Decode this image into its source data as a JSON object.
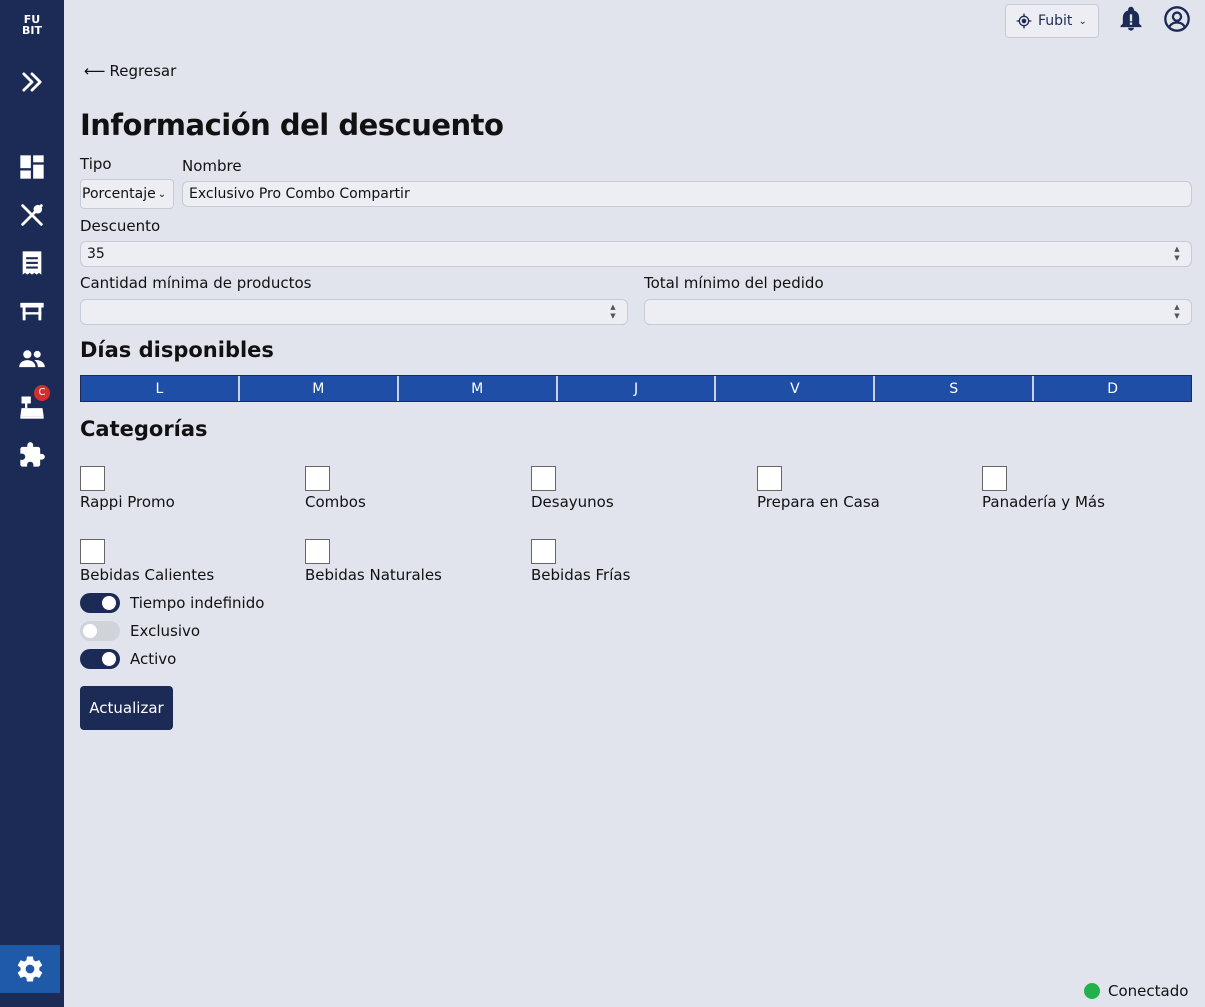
{
  "brand": {
    "logo_text": "FU BIT"
  },
  "topbar": {
    "branch_label": "Fubit"
  },
  "back_link": "Regresar",
  "page_title": "Información del descuento",
  "form": {
    "tipo_label": "Tipo",
    "tipo_value": "Porcentaje",
    "nombre_label": "Nombre",
    "nombre_value": "Exclusivo Pro Combo Compartir",
    "descuento_label": "Descuento",
    "descuento_value": "35",
    "cantidad_label": "Cantidad mínima de productos",
    "cantidad_value": "",
    "total_label": "Total mínimo del pedido",
    "total_value": ""
  },
  "days_title": "Días disponibles",
  "days": [
    "L",
    "M",
    "M",
    "J",
    "V",
    "S",
    "D"
  ],
  "categories_title": "Categorías",
  "categories": [
    {
      "label": "Rappi Promo",
      "checked": false
    },
    {
      "label": "Combos",
      "checked": false
    },
    {
      "label": "Desayunos",
      "checked": false
    },
    {
      "label": "Prepara en Casa",
      "checked": false
    },
    {
      "label": "Panadería y Más",
      "checked": false
    },
    {
      "label": "Bebidas Calientes",
      "checked": false
    },
    {
      "label": "Bebidas Naturales",
      "checked": false
    },
    {
      "label": "Bebidas Frías",
      "checked": false
    }
  ],
  "toggles": [
    {
      "label": "Tiempo indefinido",
      "on": true
    },
    {
      "label": "Exclusivo",
      "on": false
    },
    {
      "label": "Activo",
      "on": true
    }
  ],
  "update_button": "Actualizar",
  "status": {
    "text": "Conectado",
    "color": "#22b14c"
  },
  "colors": {
    "sidebar": "#1c2b55",
    "accent": "#1e4ea6",
    "background": "#e1e4ec"
  },
  "sidebar_icons": [
    "expand-icon",
    "dashboard-icon",
    "utensils-icon",
    "receipt-icon",
    "table-icon",
    "users-icon",
    "cash-register-icon",
    "puzzle-icon",
    "gear-icon"
  ],
  "cash_badge": "C"
}
